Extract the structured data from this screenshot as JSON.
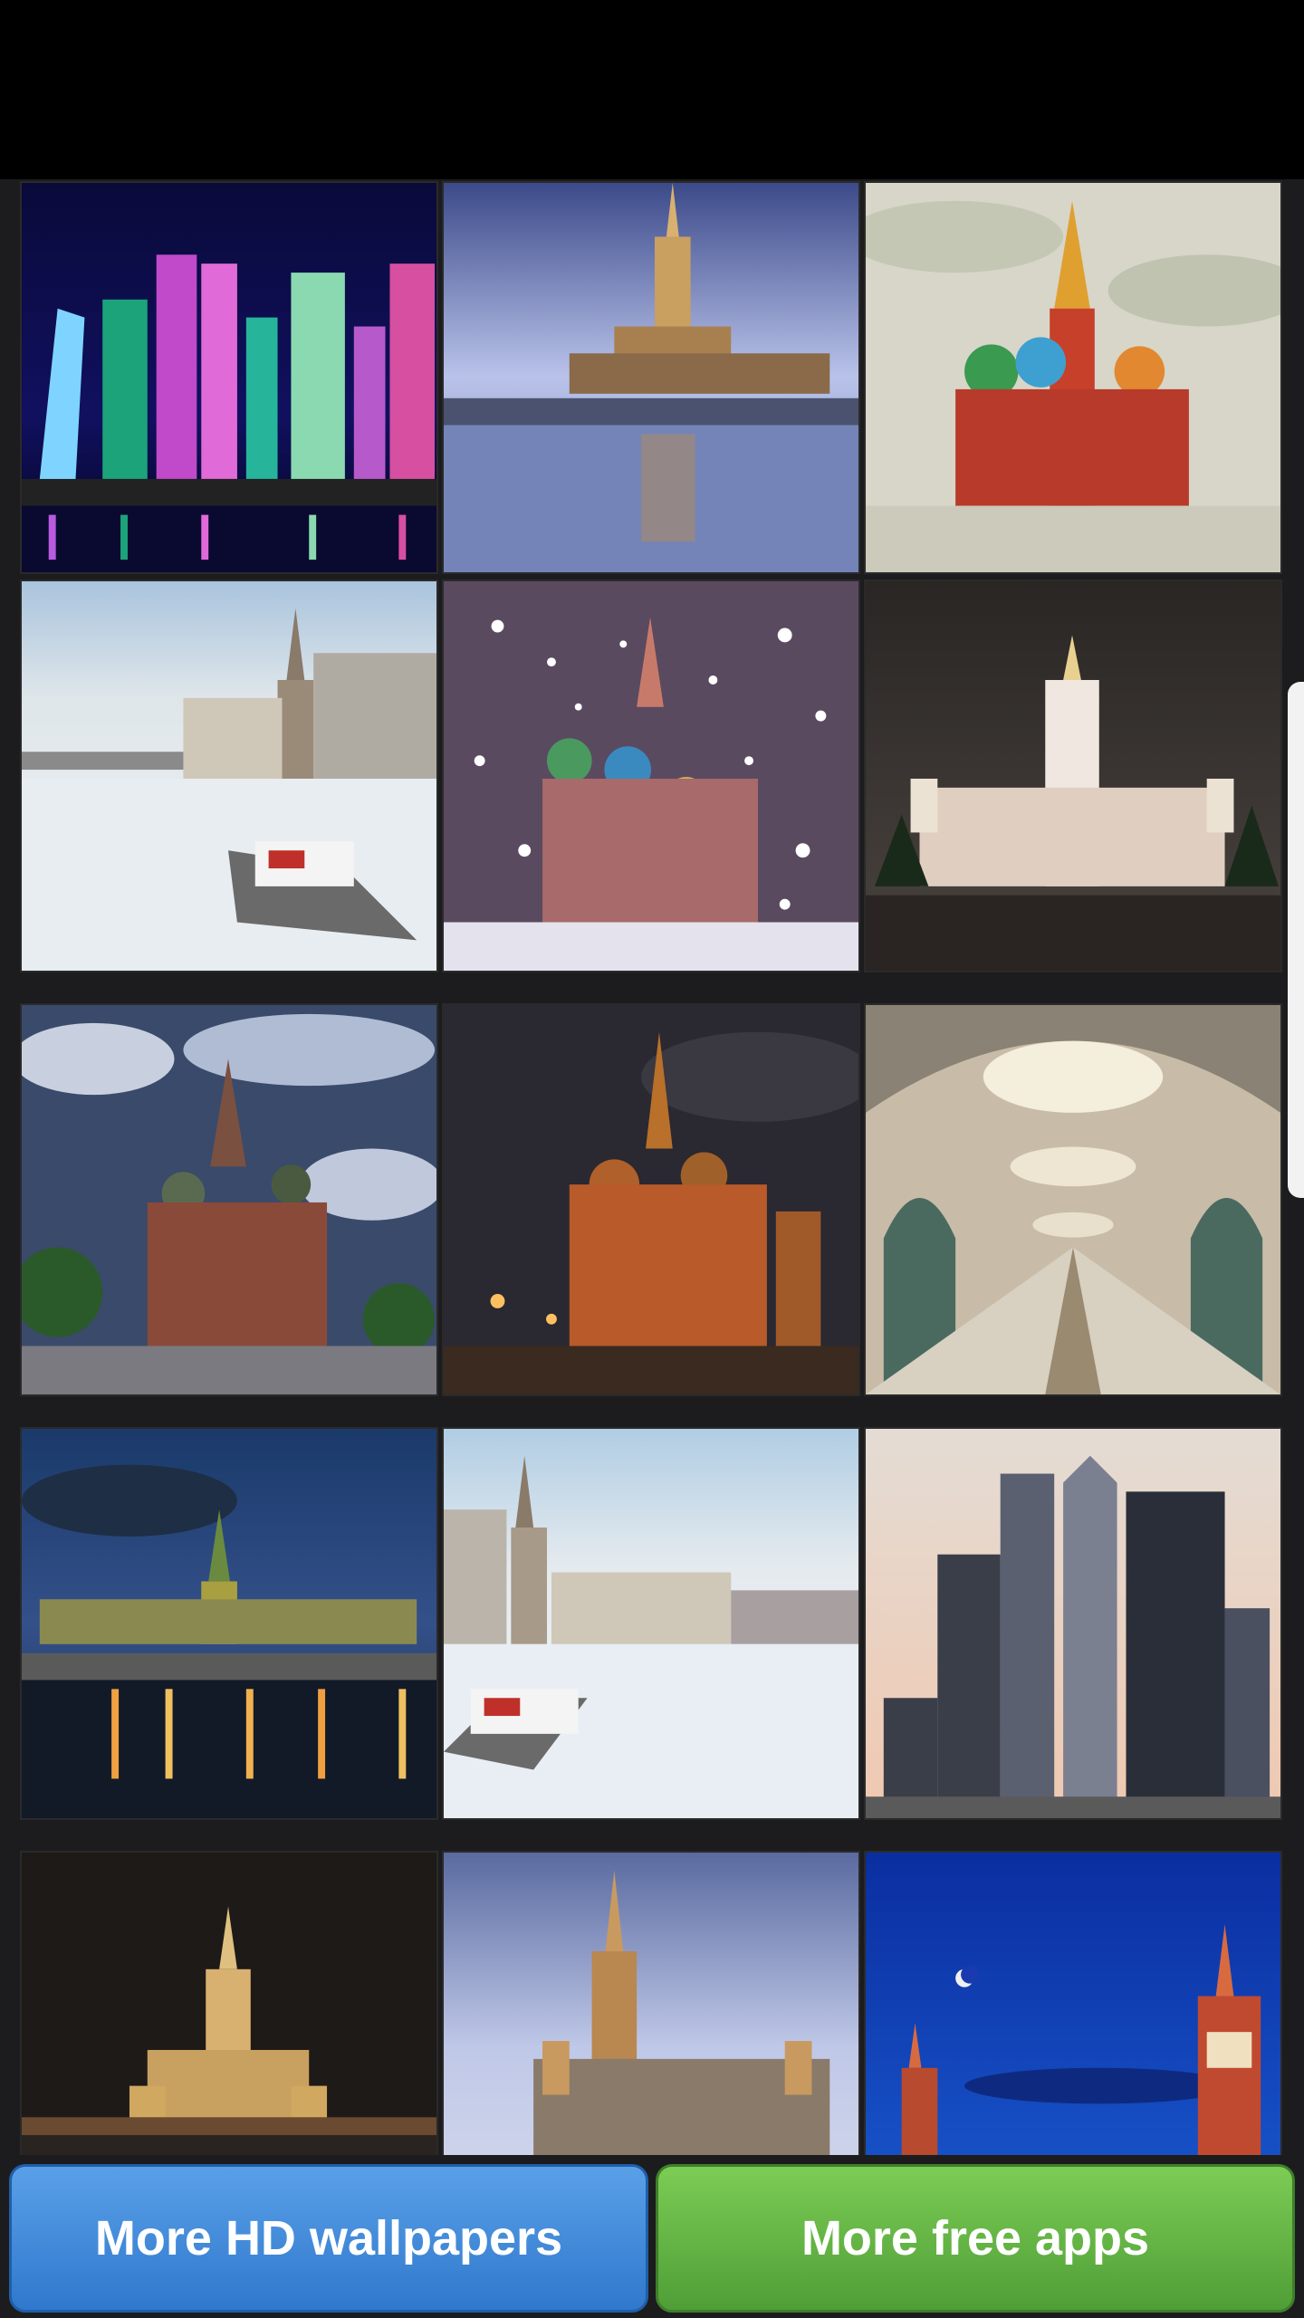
{
  "gallery": {
    "tiles": [
      {
        "icon": "moscow-city-skyscrapers-night-thumbnail"
      },
      {
        "icon": "hotel-ukraina-river-thumbnail"
      },
      {
        "icon": "saint-basils-cathedral-day-thumbnail"
      },
      {
        "icon": "frozen-river-icebreaker-thumbnail"
      },
      {
        "icon": "saint-basils-snowfall-thumbnail"
      },
      {
        "icon": "moscow-state-university-night-thumbnail"
      },
      {
        "icon": "saint-basils-hdr-thumbnail"
      },
      {
        "icon": "saint-basils-night-thumbnail"
      },
      {
        "icon": "metro-station-hall-thumbnail"
      },
      {
        "icon": "kremlin-embankment-evening-thumbnail"
      },
      {
        "icon": "frozen-river-icebreaker-2-thumbnail"
      },
      {
        "icon": "moscow-city-towers-day-thumbnail"
      },
      {
        "icon": "hotel-ukraina-night-thumbnail"
      },
      {
        "icon": "hotel-ukraina-dusk-thumbnail"
      },
      {
        "icon": "kremlin-tower-blue-sky-thumbnail"
      }
    ]
  },
  "actions": {
    "more_wallpapers_label": "More HD wallpapers",
    "more_apps_label": "More free apps"
  },
  "colors": {
    "button_blue": "#3a86d6",
    "button_green": "#5eaf41",
    "background": "#000000"
  }
}
